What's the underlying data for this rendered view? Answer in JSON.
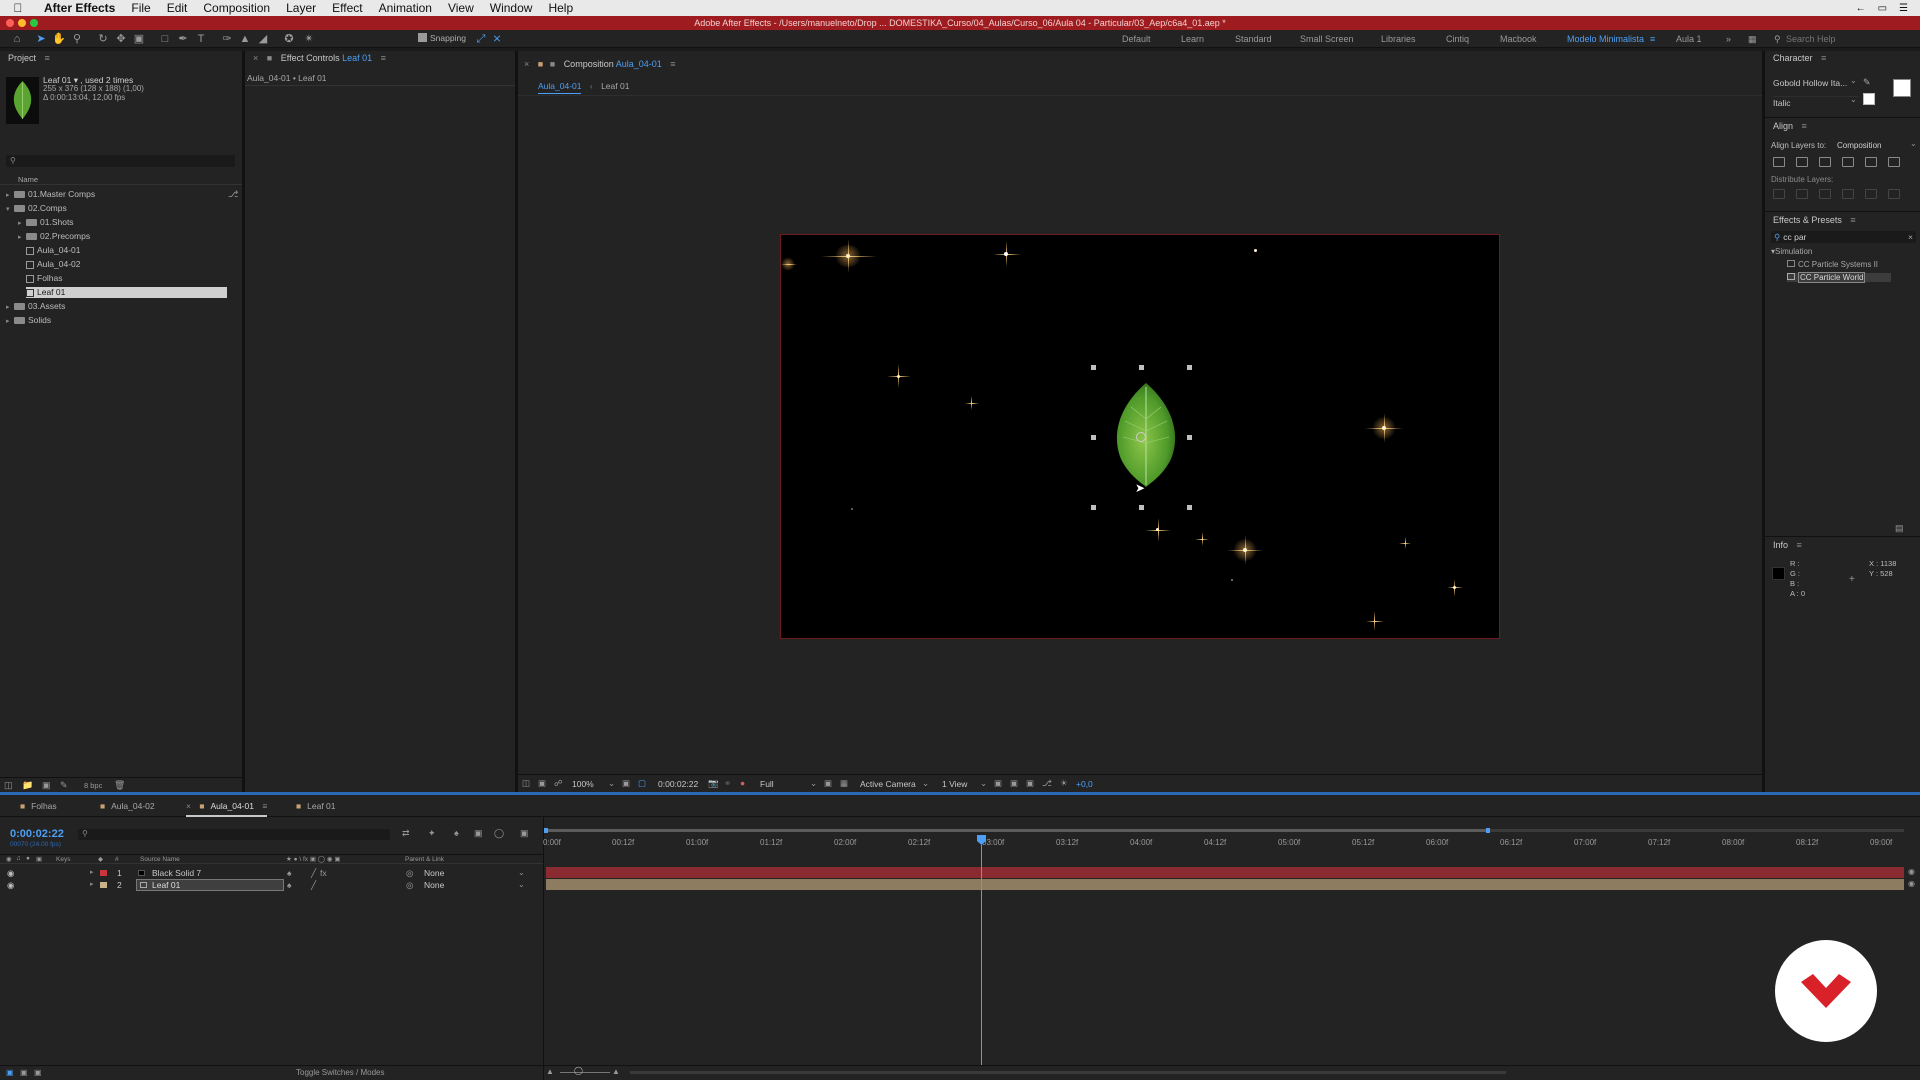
{
  "menubar": {
    "apple": "",
    "app_name": "After Effects",
    "items": [
      "File",
      "Edit",
      "Composition",
      "Layer",
      "Effect",
      "Animation",
      "View",
      "Window",
      "Help"
    ]
  },
  "window": {
    "title": "Adobe After Effects - /Users/manuelneto/Drop ... DOMESTIKA_Curso/04_Aulas/Curso_06/Aula 04 - Particular/03_Aep/c6a4_01.aep *"
  },
  "toolbar": {
    "snapping_label": "Snapping",
    "workspaces": [
      "Default",
      "Learn",
      "Standard",
      "Small Screen",
      "Libraries",
      "Cintiq",
      "Macbook",
      "Modelo Minimalista",
      "Aula 1"
    ],
    "active_workspace": "Modelo Minimalista",
    "search_help_placeholder": "Search Help"
  },
  "project": {
    "panel_title": "Project",
    "preview_name": "Leaf 01 ▾ , used 2 times",
    "preview_dims": "255 x 376  (128 x 188) (1,00)",
    "preview_duration": "Δ 0:00:13:04, 12,00 fps",
    "column_name": "Name",
    "bpc": "8 bpc",
    "items": [
      {
        "label": "01.Master Comps",
        "type": "folder",
        "expanded": false
      },
      {
        "label": "02.Comps",
        "type": "folder",
        "expanded": true
      },
      {
        "label": "01.Shots",
        "type": "folder",
        "expanded": false
      },
      {
        "label": "02.Precomps",
        "type": "folder",
        "expanded": false
      },
      {
        "label": "Aula_04-01",
        "type": "comp"
      },
      {
        "label": "Aula_04-02",
        "type": "comp"
      },
      {
        "label": "Folhas",
        "type": "comp"
      },
      {
        "label": "Leaf 01",
        "type": "comp",
        "selected": true
      },
      {
        "label": "03.Assets",
        "type": "folder",
        "expanded": false
      },
      {
        "label": "Solids",
        "type": "folder",
        "expanded": false
      }
    ]
  },
  "effect_controls": {
    "title_prefix": "Effect Controls",
    "title_layer": "Leaf 01",
    "subtitle": "Aula_04-01 • Leaf 01"
  },
  "composition": {
    "title_prefix": "Composition",
    "title_name": "Aula_04-01",
    "breadcrumb": [
      "Aula_04-01",
      "Leaf 01"
    ],
    "footer": {
      "zoom": "100%",
      "timecode": "0:00:02:22",
      "resolution": "Full",
      "camera": "Active Camera",
      "views": "1 View",
      "exposure": "+0,0"
    }
  },
  "character": {
    "panel_title": "Character",
    "font_family": "Gobold Hollow Ita...",
    "font_style": "Italic"
  },
  "align": {
    "panel_title": "Align",
    "align_to_label": "Align Layers to:",
    "align_to_value": "Composition",
    "distribute_label": "Distribute Layers:"
  },
  "effects_presets": {
    "panel_title": "Effects & Presets",
    "search_value": "cc par",
    "category": "Simulation",
    "items": [
      {
        "label": "CC Particle Systems II",
        "selected": false
      },
      {
        "label": "CC Particle World",
        "selected": true
      }
    ]
  },
  "info": {
    "panel_title": "Info",
    "r": "R :",
    "g": "G :",
    "b": "B :",
    "a": "A :  0",
    "x": "X : 1138",
    "y": "Y : 528"
  },
  "timeline": {
    "tabs": [
      {
        "label": "Folhas",
        "active": false
      },
      {
        "label": "Aula_04-02",
        "active": false
      },
      {
        "label": "Aula_04-01",
        "active": true
      },
      {
        "label": "Leaf 01",
        "active": false
      }
    ],
    "current_time": "0:00:02:22",
    "current_frame": "00070 (24.00 fps)",
    "columns": {
      "keys": "Keys",
      "num": "#",
      "source_name": "Source Name",
      "parent": "Parent & Link"
    },
    "layers": [
      {
        "num": "1",
        "name": "Black Solid 7",
        "parent": "None",
        "color": "#c8363c"
      },
      {
        "num": "2",
        "name": "Leaf 01",
        "parent": "None",
        "color": "#c9b18a"
      }
    ],
    "ruler_ticks": [
      "0:00f",
      "00:12f",
      "01:00f",
      "01:12f",
      "02:00f",
      "02:12f",
      "03:00f",
      "03:12f",
      "04:00f",
      "04:12f",
      "05:00f",
      "05:12f",
      "06:00f",
      "06:12f",
      "07:00f",
      "07:12f",
      "08:00f",
      "08:12f",
      "09:00f"
    ],
    "playhead_time": "02:22",
    "toggle_label": "Toggle Switches / Modes"
  },
  "colors": {
    "accent": "#4d9ff5",
    "title_bar": "#9e1c1f",
    "layer1_bar": "#8a2a31",
    "layer2_bar": "#8d7c60",
    "leaf": "#5aa431"
  }
}
